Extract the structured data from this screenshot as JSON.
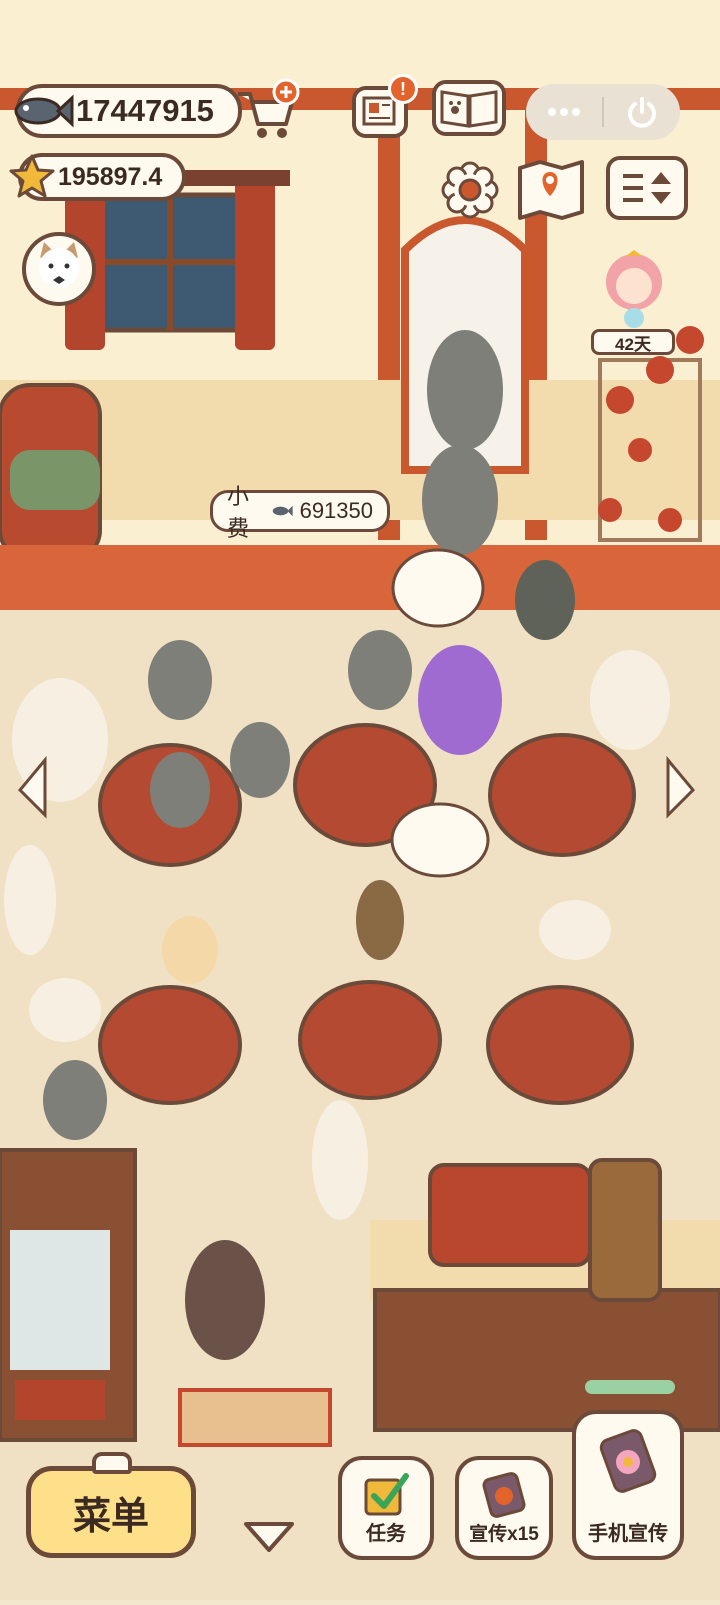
{
  "currency": {
    "fish_amount": "17447915",
    "star_amount": "195897.4"
  },
  "tip": {
    "label": "小费",
    "amount": "691350"
  },
  "notifications": {
    "news_badge": "!"
  },
  "event": {
    "days_left": "42天"
  },
  "bottom_bar": {
    "menu_label": "菜单",
    "tasks_label": "任务",
    "promote_x15_label": "宣传x15",
    "phone_promote_label": "手机宣传"
  },
  "icons": {
    "fish": "fish-icon",
    "star": "star-icon",
    "cart": "shopping-cart-plus-icon",
    "news": "newspaper-icon",
    "guide": "paw-book-icon",
    "more": "more-dots-icon",
    "power": "power-icon",
    "settings": "gear-icon",
    "map": "map-icon",
    "layout": "edit-layout-icon"
  },
  "colors": {
    "background": "#f3e7cf",
    "border": "#6b4a3a",
    "panel": "#fffaf0",
    "badge": "#e2642c",
    "menu_button": "#ffe08a",
    "wall": "#fbefd2",
    "beam": "#c9582f",
    "floor": "#f0e1c4",
    "rug": "#d9663b",
    "table_cloth": "#b54a32"
  }
}
